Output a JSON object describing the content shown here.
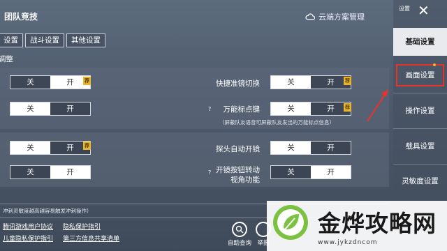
{
  "header": {
    "title": "团队竞技",
    "cloud_label": "云端方案管理"
  },
  "tabs": [
    "设置",
    "战斗设置",
    "其他设置"
  ],
  "section_title": "调整",
  "rows": [
    {
      "left_toggle": {
        "off": "关",
        "on": "开",
        "badge": "荐"
      },
      "right_label": "快捷准镜切换",
      "right_toggle": {
        "off": "关",
        "on": "开",
        "badge": "荐"
      }
    },
    {
      "left_toggle": {
        "off": "关",
        "on": "开"
      },
      "right_label": "万能标点键",
      "right_help": "?",
      "right_toggle": {
        "off": "关",
        "on": "开",
        "badge": "荐"
      },
      "hint": "（屏蔽队友语音可屏蔽队友发出的万能标点信息）"
    },
    {
      "left_toggle": {
        "off": "关",
        "on": "开",
        "badge": "荐"
      },
      "right_label": "探头自动开镜",
      "right_toggle": {
        "off": "关",
        "on": "开"
      }
    },
    {
      "left_toggle": {
        "off": "关",
        "on": "开"
      },
      "right_label": "开镜按钮转动\n视角功能",
      "right_label_line1": "开镜按钮转动",
      "right_label_line2": "视角功能",
      "right_help": "?",
      "right_toggle": {
        "off": "关",
        "on": "开"
      }
    }
  ],
  "footnote": "冲刺灵敏度越高越容易触发冲刺操作）",
  "footer_links": {
    "row1": [
      "腾讯游戏用户协议",
      "隐私保护指引"
    ],
    "row2": [
      "儿童隐私保护指引",
      "第三方信息共享清单"
    ]
  },
  "round_buttons": [
    {
      "label": "自助查询",
      "icon": "magnifier-icon"
    },
    {
      "label": "举报",
      "icon": "report-icon"
    }
  ],
  "sidebar": {
    "top_label": "设置",
    "close": "✕",
    "items": [
      "基础设置",
      "画面设置",
      "操作设置",
      "载具设置",
      "灵敏度设置"
    ],
    "active_index": 0,
    "highlight_index": 1,
    "highlight_color": "#e8332b"
  },
  "watermark": {
    "brand": "金烨攻略网",
    "url": "www.jykzdncom"
  },
  "colors": {
    "accent_badge": "#e8b62c",
    "highlight": "#e8332b"
  }
}
